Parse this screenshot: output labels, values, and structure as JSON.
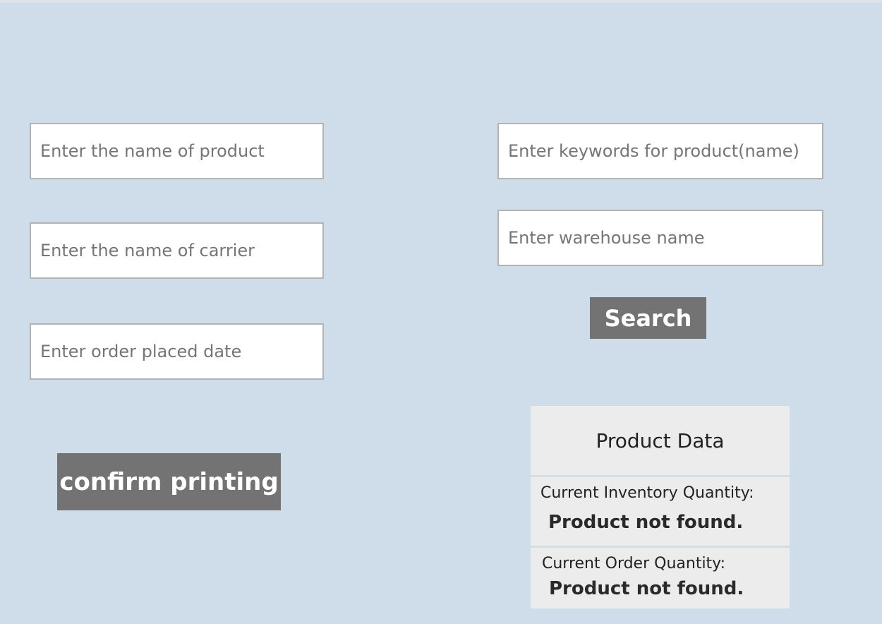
{
  "left_form": {
    "product_placeholder": "Enter the name of product",
    "carrier_placeholder": "Enter the name of carrier",
    "date_placeholder": "Enter order placed date",
    "confirm_label": "confirm printing"
  },
  "right_form": {
    "keywords_placeholder": "Enter keywords for product(name)",
    "warehouse_placeholder": "Enter warehouse name",
    "search_label": "Search"
  },
  "product_data": {
    "title": "Product Data",
    "inventory_label": "Current Inventory Quantity:",
    "inventory_value": "Product not found.",
    "order_label": "Current Order Quantity:",
    "order_value": "Product not found."
  },
  "colors": {
    "background": "#cedde9",
    "button": "#737373",
    "card": "#ececec"
  }
}
